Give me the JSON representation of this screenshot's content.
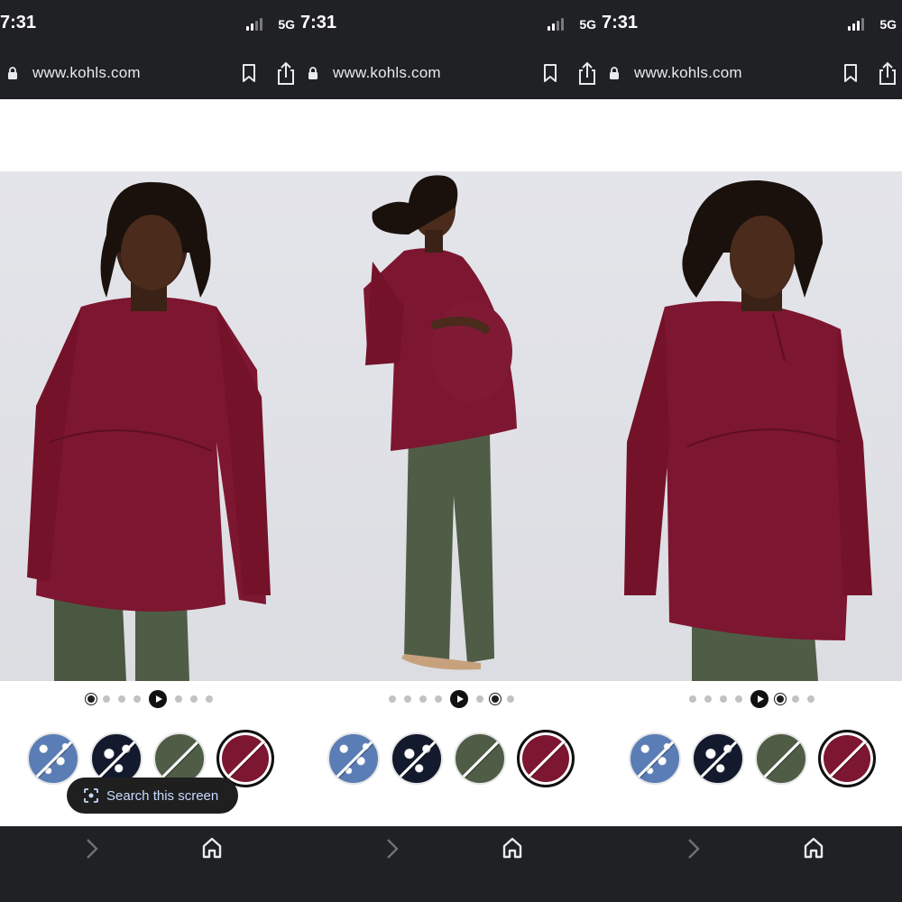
{
  "panels": [
    {
      "status": {
        "time": "7:31",
        "network": "5G"
      },
      "browser": {
        "url": "www.kohls.com"
      },
      "carousel": {
        "dots_before": 4,
        "dots_after": 3,
        "active_dot": 0
      },
      "swatches": [
        {
          "name": "blue-floral",
          "selected": false
        },
        {
          "name": "navy-floral",
          "selected": false
        },
        {
          "name": "olive",
          "selected": false
        },
        {
          "name": "wine",
          "selected": true
        }
      ],
      "chip": {
        "label": "Search this screen",
        "icon": "lens-icon"
      }
    },
    {
      "status": {
        "time": "7:31",
        "network": "5G"
      },
      "browser": {
        "url": "www.kohls.com"
      },
      "carousel": {
        "dots_before": 4,
        "dots_after": 3,
        "active_dot": 5
      },
      "swatches": [
        {
          "name": "blue-floral",
          "selected": false
        },
        {
          "name": "navy-floral",
          "selected": false
        },
        {
          "name": "olive",
          "selected": false
        },
        {
          "name": "wine",
          "selected": true
        }
      ]
    },
    {
      "status": {
        "time": "7:31",
        "network": "5G"
      },
      "browser": {
        "url": "www.kohls.com"
      },
      "carousel": {
        "dots_before": 4,
        "dots_after": 3,
        "active_dot": 4
      },
      "swatches": [
        {
          "name": "blue-floral",
          "selected": false
        },
        {
          "name": "navy-floral",
          "selected": false
        },
        {
          "name": "olive",
          "selected": false
        },
        {
          "name": "wine",
          "selected": true
        }
      ]
    }
  ],
  "colors": {
    "chrome": "#202124",
    "top_color": "#7d1630",
    "pants_color": "#4f5d46"
  }
}
